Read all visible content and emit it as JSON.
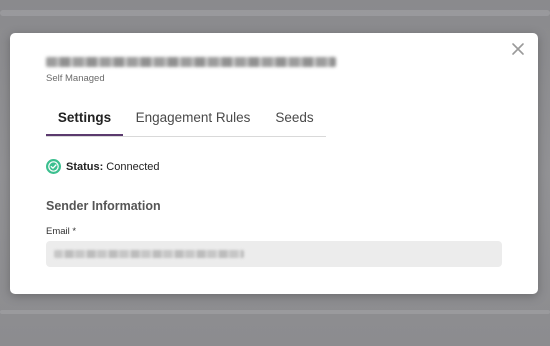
{
  "dialog": {
    "subtitle": "Self Managed",
    "tabs": [
      {
        "label": "Settings",
        "active": true
      },
      {
        "label": "Engagement Rules",
        "active": false
      },
      {
        "label": "Seeds",
        "active": false
      }
    ],
    "status": {
      "label": "Status:",
      "value": "Connected",
      "color": "#3cbf8f"
    },
    "sender_section": {
      "title": "Sender Information",
      "email_label": "Email *"
    },
    "accent_color": "#5b3a6e",
    "icons": {
      "close": "close-icon",
      "status": "check-circle-icon"
    }
  }
}
